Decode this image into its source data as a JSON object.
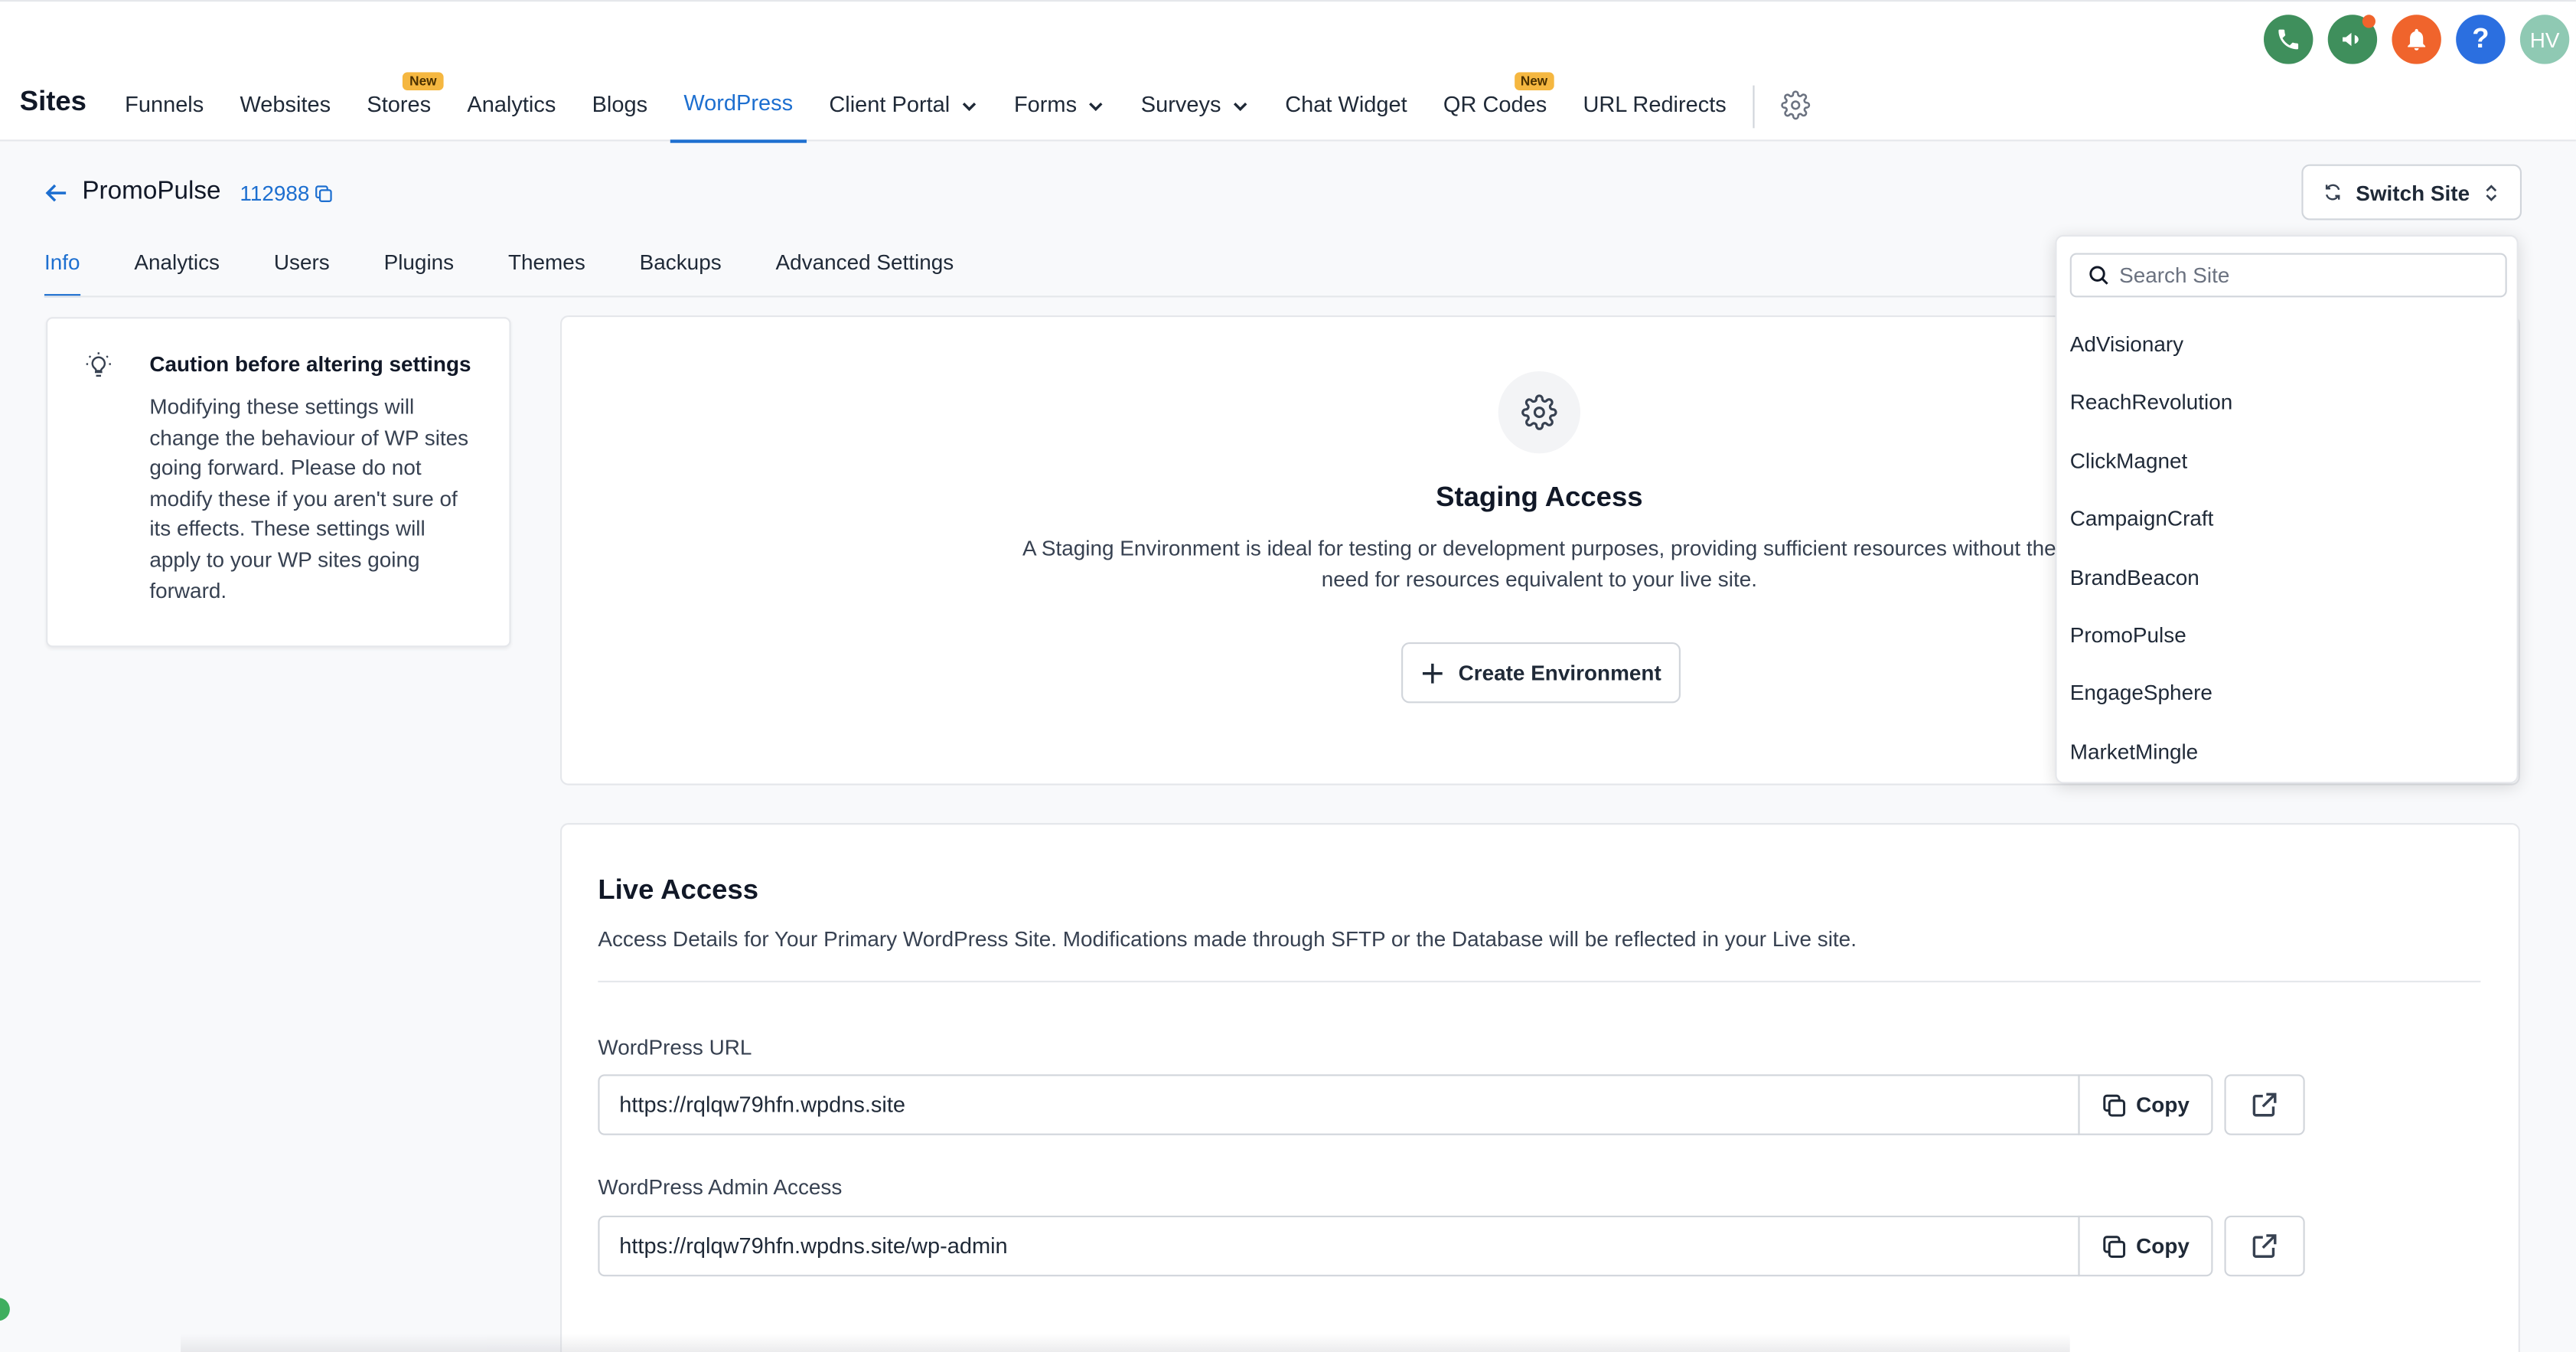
{
  "header": {
    "brand": "Sites",
    "nav": [
      {
        "label": "Funnels"
      },
      {
        "label": "Websites"
      },
      {
        "label": "Stores",
        "badge": "New"
      },
      {
        "label": "Analytics"
      },
      {
        "label": "Blogs"
      },
      {
        "label": "WordPress",
        "active": true
      },
      {
        "label": "Client Portal",
        "dropdown": true
      },
      {
        "label": "Forms",
        "dropdown": true
      },
      {
        "label": "Surveys",
        "dropdown": true
      },
      {
        "label": "Chat Widget"
      },
      {
        "label": "QR Codes",
        "badge": "New"
      },
      {
        "label": "URL Redirects"
      }
    ],
    "avatar_initials": "HV",
    "help_glyph": "?",
    "colors": {
      "accent": "#1d6fd0",
      "new_badge": "#f5b740",
      "phone": "#3f8f5c",
      "bell": "#f0642c",
      "help": "#2b6fe0",
      "avatar": "#8fc9b3"
    }
  },
  "site": {
    "name": "PromoPulse",
    "id": "112988",
    "switch_label": "Switch Site"
  },
  "tabs": [
    {
      "label": "Info",
      "active": true
    },
    {
      "label": "Analytics"
    },
    {
      "label": "Users"
    },
    {
      "label": "Plugins"
    },
    {
      "label": "Themes"
    },
    {
      "label": "Backups"
    },
    {
      "label": "Advanced Settings"
    }
  ],
  "caution": {
    "title": "Caution before altering settings",
    "body": "Modifying these settings will change the behaviour of WP sites going forward. Please do not modify these if you aren't sure of its effects. These settings will apply to your WP sites going forward."
  },
  "staging": {
    "title": "Staging Access",
    "description": "A Staging Environment is ideal for testing or development purposes, providing sufficient resources without the need for resources equivalent to your live site.",
    "create_label": "Create Environment"
  },
  "live": {
    "title": "Live Access",
    "description": "Access Details for Your Primary WordPress Site. Modifications made through SFTP or the Database will be reflected in your Live site.",
    "url_label": "WordPress URL",
    "url_value": "https://rqlqw79hfn.wpdns.site",
    "admin_label": "WordPress Admin Access",
    "admin_value": "https://rqlqw79hfn.wpdns.site/wp-admin",
    "copy_label": "Copy"
  },
  "switcher": {
    "search_placeholder": "Search Site",
    "sites": [
      "AdVisionary",
      "ReachRevolution",
      "ClickMagnet",
      "CampaignCraft",
      "BrandBeacon",
      "PromoPulse",
      "EngageSphere",
      "MarketMingle"
    ]
  }
}
